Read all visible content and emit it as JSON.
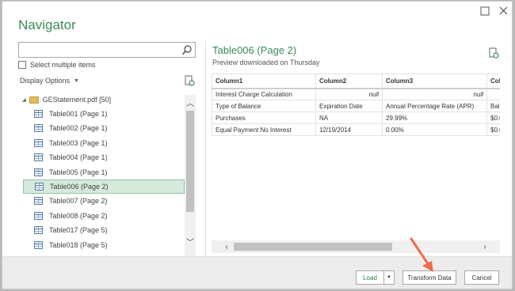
{
  "window": {
    "title": "Navigator"
  },
  "left_panel": {
    "search_placeholder": "",
    "select_multiple_label": "Select multiple items",
    "display_options_label": "Display Options",
    "tree": {
      "root_label": "GEStatement.pdf [50]",
      "items": [
        {
          "label": "Table001 (Page 1)",
          "selected": false
        },
        {
          "label": "Table002 (Page 1)",
          "selected": false
        },
        {
          "label": "Table003 (Page 1)",
          "selected": false
        },
        {
          "label": "Table004 (Page 1)",
          "selected": false
        },
        {
          "label": "Table005 (Page 1)",
          "selected": false
        },
        {
          "label": "Table006 (Page 2)",
          "selected": true
        },
        {
          "label": "Table007 (Page 2)",
          "selected": false
        },
        {
          "label": "Table008 (Page 2)",
          "selected": false
        },
        {
          "label": "Table017 (Page 5)",
          "selected": false
        },
        {
          "label": "Table018 (Page 5)",
          "selected": false
        }
      ]
    }
  },
  "preview": {
    "title": "Table006 (Page 2)",
    "subtitle": "Preview downloaded on Thursday",
    "columns": [
      "Column1",
      "Column2",
      "Column3",
      "Colu"
    ],
    "rows": [
      [
        "Interest Charge Calculation",
        "null",
        "null",
        ""
      ],
      [
        "Type of Balance",
        "Expiration Date",
        "Annual Percentage Rate (APR)",
        "Bala"
      ],
      [
        "Purchases",
        "NA",
        "29.99%",
        "$0.0"
      ],
      [
        "Equal Payment No Interest",
        "12/19/2014",
        "0.00%",
        "$0.0"
      ]
    ]
  },
  "footer": {
    "load_label": "Load",
    "transform_label": "Transform Data",
    "cancel_label": "Cancel"
  },
  "icons": {
    "maximize": "maximize-icon",
    "close": "close-icon",
    "search": "search-icon",
    "refresh": "refresh-icon",
    "folder": "folder-icon",
    "table": "table-icon"
  },
  "colors": {
    "accent": "#3c8a58",
    "selected_bg": "#d5eadc",
    "arrow": "#f06c4d"
  }
}
